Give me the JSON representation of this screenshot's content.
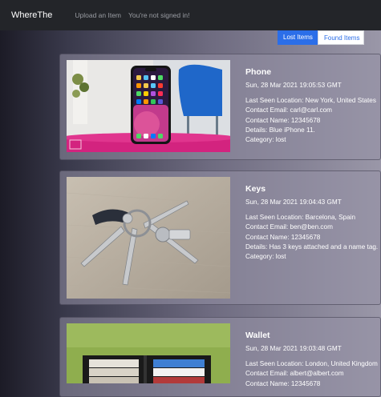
{
  "navbar": {
    "brand": "WhereThe",
    "upload_link": "Upload an Item",
    "auth_status": "You're not signed in!"
  },
  "toggle": {
    "lost_label": "Lost Items",
    "found_label": "Found Items",
    "active": "Lost Items"
  },
  "items": [
    {
      "name": "Phone",
      "date": "Sun, 28 Mar 2021 19:05:53 GMT",
      "location": "Last Seen Location: New York, United States",
      "email": "Contact Email: carl@carl.com",
      "contact_name": "Contact Name: 12345678",
      "details": "Details: Blue iPhone 11.",
      "category": "Category: lost"
    },
    {
      "name": "Keys",
      "date": "Sun, 28 Mar 2021 19:04:43 GMT",
      "location": "Last Seen Location: Barcelona, Spain",
      "email": "Contact Email: ben@ben.com",
      "contact_name": "Contact Name: 12345678",
      "details": "Details: Has 3 keys attached and a name tag.",
      "category": "Category: lost"
    },
    {
      "name": "Wallet",
      "date": "Sun, 28 Mar 2021 19:03:48 GMT",
      "location": "Last Seen Location: London, United Kingdom",
      "email": "Contact Email: albert@albert.com",
      "contact_name": "Contact Name: 12345678"
    }
  ],
  "colors": {
    "navbar_bg": "#232529",
    "accent_blue": "#2b6ee8",
    "card_bg": "#9692a6"
  }
}
